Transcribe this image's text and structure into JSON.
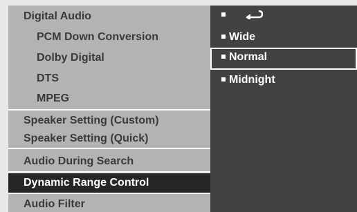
{
  "menu": {
    "items": [
      {
        "label": "Digital Audio"
      },
      {
        "label": "PCM Down Conversion"
      },
      {
        "label": "Dolby Digital"
      },
      {
        "label": "DTS"
      },
      {
        "label": "MPEG"
      },
      {
        "label": "Speaker Setting (Custom)"
      },
      {
        "label": "Speaker Setting (Quick)"
      },
      {
        "label": "Audio  During Search"
      },
      {
        "label": "Dynamic Range Control"
      },
      {
        "label": "Audio Filter"
      }
    ],
    "selected": "Dynamic Range Control"
  },
  "options": {
    "return_icon": "return-arrow-icon",
    "items": [
      {
        "label": "Wide"
      },
      {
        "label": "Normal"
      },
      {
        "label": "Midnight"
      }
    ],
    "highlighted": "Normal"
  },
  "colors": {
    "left_panel": "#b3b3b3",
    "right_panel": "#424242",
    "selected_row": "#262626",
    "text_dark": "#3a3a3a",
    "text_light": "#ffffff"
  }
}
